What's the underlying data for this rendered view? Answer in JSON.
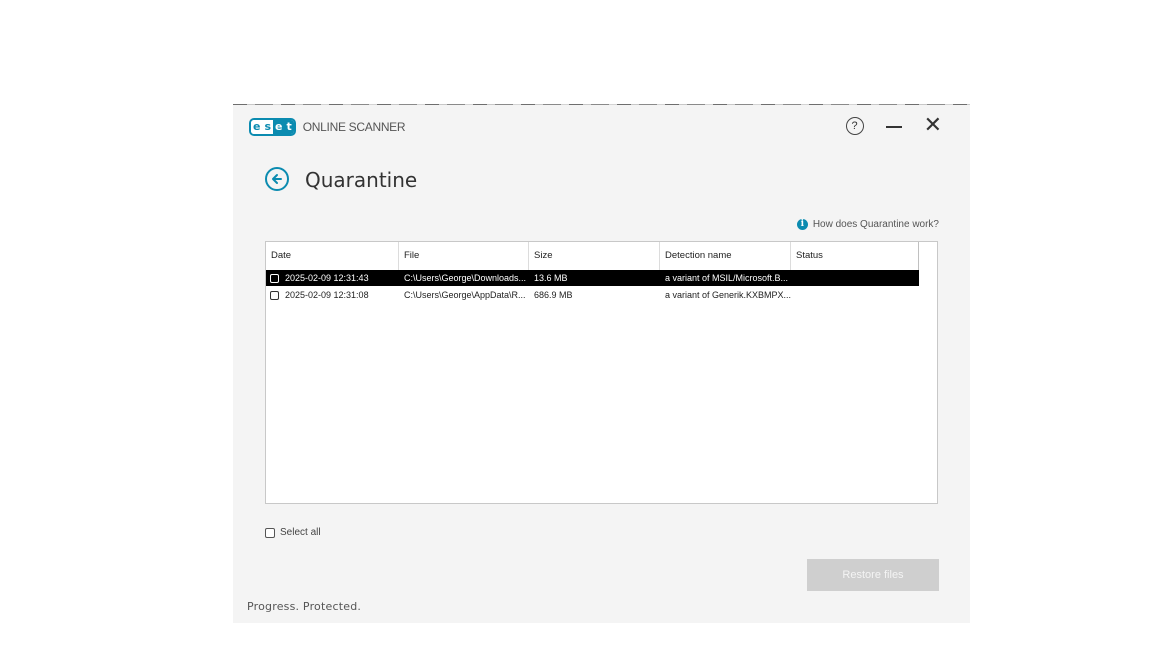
{
  "app": {
    "logo_letters": [
      "e",
      "s",
      "e",
      "t"
    ],
    "title": "ONLINE SCANNER",
    "brand_color": "#0b8bb0"
  },
  "title_bar": {
    "help_label": "?",
    "minimize_label": "—",
    "close_label": "✕"
  },
  "page": {
    "title": "Quarantine",
    "back_icon": "arrow-left-circle-icon",
    "help_link": "How does Quarantine work?",
    "help_icon_glyph": "i"
  },
  "table": {
    "columns": [
      "Date",
      "File",
      "Size",
      "Detection name",
      "Status"
    ],
    "rows": [
      {
        "date": "2025-02-09 12:31:43",
        "file": "C:\\Users\\George\\Downloads...",
        "size": "13.6 MB",
        "detection": "a variant of MSIL/Microsoft.B...",
        "status": "",
        "selected": true
      },
      {
        "date": "2025-02-09 12:31:08",
        "file": "C:\\Users\\George\\AppData\\R...",
        "size": "686.9 MB",
        "detection": "a variant of Generik.KXBMPX...",
        "status": "",
        "selected": false
      }
    ]
  },
  "footer": {
    "select_all_label": "Select all",
    "restore_button_label": "Restore files",
    "tagline": "Progress. Protected."
  }
}
